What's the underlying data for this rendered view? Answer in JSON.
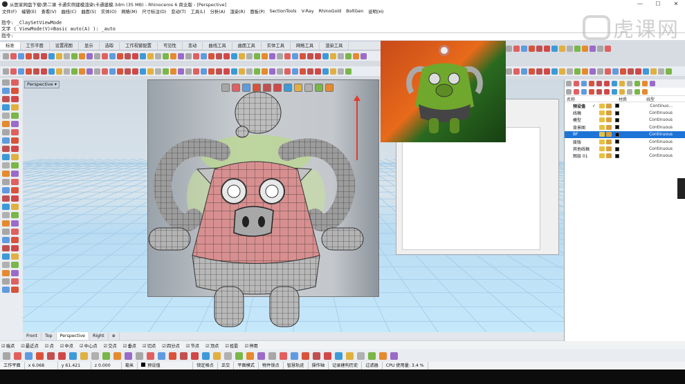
{
  "window": {
    "title": "从医家网盘下载\\第二课 卡通实例建模渲染\\卡通建模.3dm (35 MB) - Rhinoceros 6 商业版 - [Perspective]",
    "controls": [
      "—",
      "☐",
      "✕"
    ]
  },
  "menu": [
    "文件(F)",
    "编辑(E)",
    "查看(V)",
    "曲线(C)",
    "曲面(S)",
    "实体(O)",
    "网格(M)",
    "尺寸标注(D)",
    "变动(T)",
    "工具(L)",
    "分析(A)",
    "渲染(R)",
    "面板(P)",
    "SectionTools",
    "V-Ray",
    "RhinoGold",
    "BoltGen",
    "说明(H)"
  ],
  "command": {
    "line0": "",
    "line1": "指令: _ClaySetViewMode",
    "line2": "文字 ( ViewMode(V)=Basic  auto(A) ): _auto",
    "prompt": "指令:"
  },
  "watermark": "虎课网",
  "toolbar_tabs": [
    "标准",
    "工作平面",
    "设置视图",
    "显示",
    "选取",
    "工作视窗配置",
    "可见性",
    "变动",
    "曲线工具",
    "曲面工具",
    "实体工具",
    "网格工具",
    "渲染工具"
  ],
  "active_tab": "标准",
  "viewport": {
    "label": "Perspective",
    "tabs": [
      "Front",
      "Top",
      "Perspective",
      "Right",
      "⊕"
    ],
    "active_tab": "Perspective"
  },
  "layers": {
    "headers": [
      "名称",
      "材质",
      "线型"
    ],
    "rows": [
      {
        "name": "预设值",
        "check": "✓",
        "color": "#000000",
        "linetype": "Continuo...",
        "selected": false,
        "bold": true
      },
      {
        "name": "线稿",
        "check": "",
        "color": "#000000",
        "linetype": "Continuous",
        "selected": false,
        "bold": false
      },
      {
        "name": "模型",
        "check": "",
        "color": "#000000",
        "linetype": "Continuous",
        "selected": false,
        "bold": false
      },
      {
        "name": "背景图",
        "check": "",
        "color": "#000000",
        "linetype": "Continuous",
        "selected": false,
        "bold": false
      },
      {
        "name": "BF",
        "check": "",
        "color": "#000000",
        "linetype": "Continuous",
        "selected": true,
        "bold": false
      },
      {
        "name": "废版",
        "check": "",
        "color": "#000000",
        "linetype": "Continuous",
        "selected": false,
        "bold": false
      },
      {
        "name": "其他线稿",
        "check": "",
        "color": "#000000",
        "linetype": "Continuous",
        "selected": false,
        "bold": false
      },
      {
        "name": "图层 01",
        "check": "",
        "color": "#000000",
        "linetype": "Continuous",
        "selected": false,
        "bold": false
      }
    ]
  },
  "osnap": [
    "端点",
    "最近点",
    "点",
    "中点",
    "中心点",
    "交点",
    "垂点",
    "切点",
    "四分点",
    "节点",
    "顶点",
    "投影",
    "停用"
  ],
  "status": {
    "plane": "工作平面",
    "x": "x 6.068",
    "y": "y 61.421",
    "z": "z 0.000",
    "unit": "毫米",
    "layer": "预设值",
    "items": [
      "锁定格点",
      "正交",
      "平面模式",
      "物件锁点",
      "智慧轨迹",
      "操作轴",
      "记录建构历史",
      "过滤器",
      "CPU 使用量: 3.4 %"
    ]
  },
  "colors": {
    "accent": "#1e73d6",
    "viewport_bg": "#c6e8fb",
    "arrow": "#e23b2b",
    "body": "#d88f8f"
  }
}
